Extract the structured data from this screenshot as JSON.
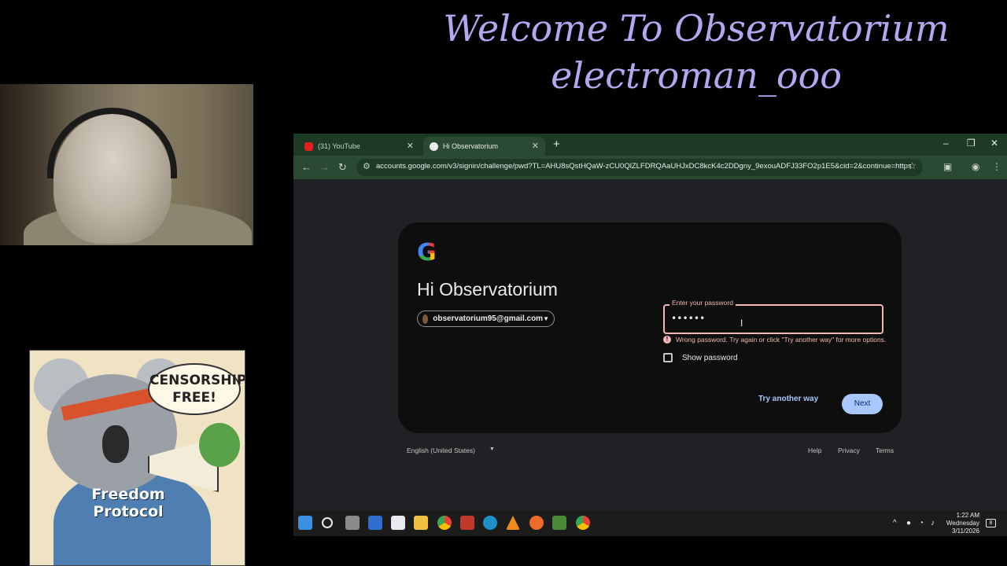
{
  "overlay": {
    "line1": "Welcome To Observatorium",
    "line2": "electroman_ooo"
  },
  "poster": {
    "bubble_line1": "CENSORSHIP",
    "bubble_line2": "FREE!",
    "shirt_line1": "Freedom",
    "shirt_line2": "Protocol"
  },
  "browser": {
    "tabs": [
      {
        "label": "(31) YouTube",
        "icon": "youtube-icon",
        "active": false
      },
      {
        "label": "Hi Observatorium",
        "icon": "google-icon",
        "active": true
      }
    ],
    "url": "accounts.google.com/v3/signin/challenge/pwd?TL=AHU8sQstHQaW-zCU0QlZLFDRQAaUHJxDC8kcK4c2DDgny_9exouADFJ33FO2p1E5&cid=2&continue=https%3A...",
    "accent_color": "#2b4a33"
  },
  "signin": {
    "greeting": "Hi Observatorium",
    "account_email": "observatorium95@gmail.com",
    "password_label": "Enter your password",
    "password_value": "••••••",
    "error_text": "Wrong password. Try again or click \"Try another way\" for more options.",
    "show_password_label": "Show password",
    "show_password_checked": false,
    "try_another_way_label": "Try another way",
    "next_label": "Next",
    "error_color": "#f2b8b5",
    "button_color": "#a8c7fa"
  },
  "footer": {
    "language": "English (United States)",
    "help": "Help",
    "privacy": "Privacy",
    "terms": "Terms"
  },
  "taskbar": {
    "time": "1:22 AM",
    "day": "Wednesday",
    "date": "3/11/2026",
    "notification_count": "8"
  }
}
